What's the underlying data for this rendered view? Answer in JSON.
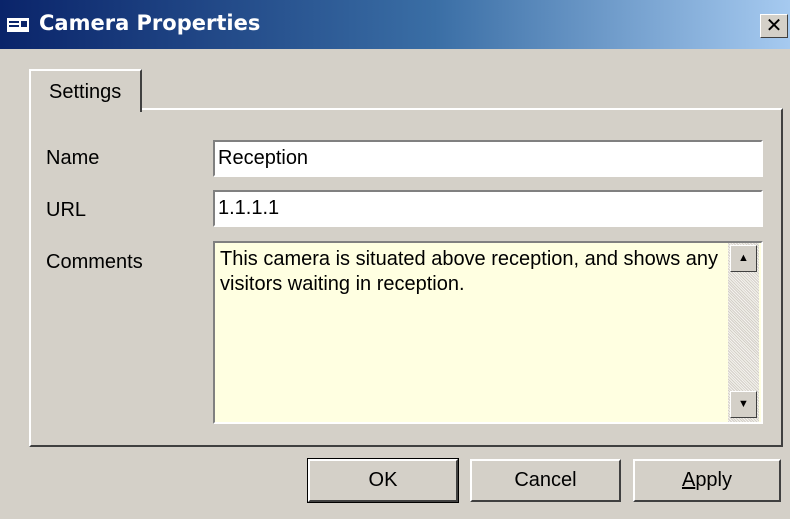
{
  "window": {
    "title": "Camera Properties",
    "icon": "camera-window-icon",
    "close_glyph": "✕"
  },
  "tabs": [
    {
      "label": "Settings",
      "active": true
    }
  ],
  "form": {
    "name_label": "Name",
    "name_value": "Reception",
    "url_label": "URL",
    "url_value": "1.1.1.1",
    "comments_label": "Comments",
    "comments_value": "This camera is situated above reception, and shows any visitors waiting in reception."
  },
  "scrollbar": {
    "up_glyph": "▲",
    "down_glyph": "▼"
  },
  "buttons": {
    "ok": "OK",
    "cancel": "Cancel",
    "apply_accel": "A",
    "apply_rest": "pply"
  },
  "colors": {
    "title_start": "#0a246a",
    "title_end": "#a6caf0",
    "face": "#d4d0c8",
    "memo_bg": "#ffffe1"
  }
}
